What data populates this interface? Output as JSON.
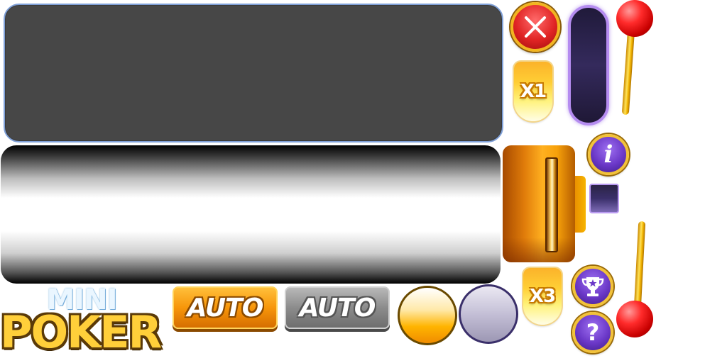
{
  "logo": {
    "line1": "MINI",
    "line2": "POKER"
  },
  "auto_buttons": {
    "active_label": "AUTO",
    "disabled_label": "AUTO"
  },
  "multipliers": {
    "x1": "X1",
    "x3": "X3"
  },
  "icons": {
    "close": "close-icon",
    "info": "info-icon",
    "trophy": "trophy-icon",
    "help": "help-icon",
    "info_glyph": "i",
    "help_glyph": "?"
  },
  "colors": {
    "panel": "#474747",
    "panel_border": "#7fa0d8",
    "gold": "#f2c23a",
    "lever_red": "#ff2b2b",
    "purple": "#6b38c8"
  }
}
